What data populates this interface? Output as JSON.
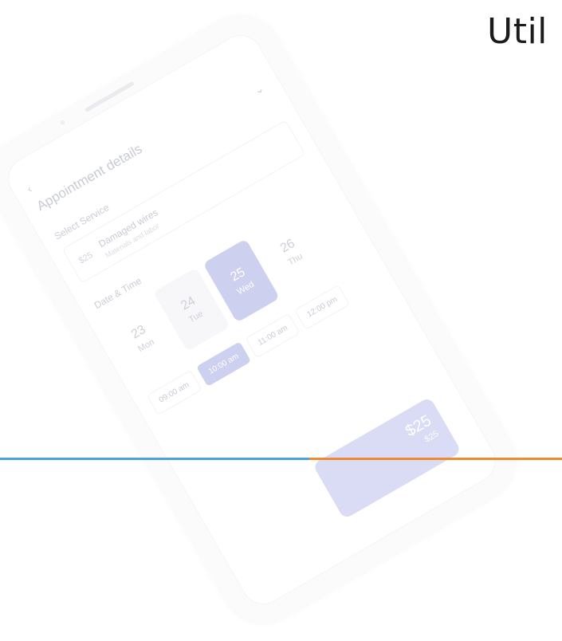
{
  "heading": "Util",
  "phone": {
    "back_label": "‹",
    "title": "Appointment details",
    "chevron": "⌄",
    "select_service_label": "Select Service",
    "service": {
      "price": "$25",
      "name": "Damaged wires",
      "subtitle": "Materials and labor"
    },
    "date_time_label": "Date & Time",
    "dates": [
      {
        "day": "23",
        "weekday": "Mon"
      },
      {
        "day": "24",
        "weekday": "Tue"
      },
      {
        "day": "25",
        "weekday": "Wed"
      },
      {
        "day": "26",
        "weekday": "Thu"
      }
    ],
    "times": [
      "09:00 am",
      "10:00 am",
      "11:00 am",
      "12:00 pm"
    ],
    "total": {
      "amount": "$25",
      "sub": "$25"
    }
  },
  "colors": {
    "accent_blue": "#4aa3df",
    "accent_orange": "#ef8a33",
    "active_date": "#c9cbee"
  }
}
